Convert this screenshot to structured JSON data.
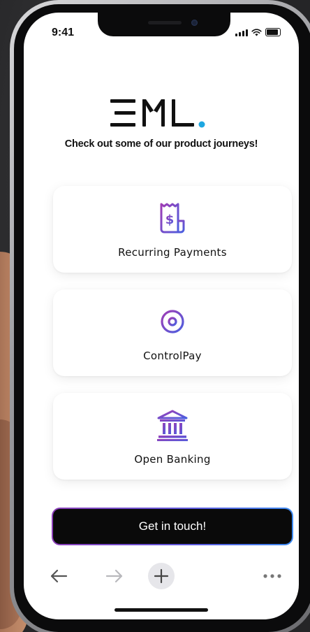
{
  "status_bar": {
    "time": "9:41"
  },
  "brand": {
    "logo_text": "EML",
    "accent_color": "#1ea7e1"
  },
  "tagline": "Check out some of our product journeys!",
  "cards": [
    {
      "label": "Recurring Payments",
      "icon": "receipt-dollar-icon"
    },
    {
      "label": "ControlPay",
      "icon": "target-crosshair-icon"
    },
    {
      "label": "Open Banking",
      "icon": "bank-building-icon"
    }
  ],
  "cta": {
    "label": "Get in touch!"
  },
  "browser_toolbar": {
    "back_icon": "arrow-left-icon",
    "forward_icon": "arrow-right-icon",
    "new_tab_icon": "plus-icon",
    "more_icon": "more-dots-icon"
  },
  "colors": {
    "icon_gradient_start": "#a03cb4",
    "icon_gradient_end": "#4a5fe0",
    "cta_background": "#0a0a0a"
  }
}
